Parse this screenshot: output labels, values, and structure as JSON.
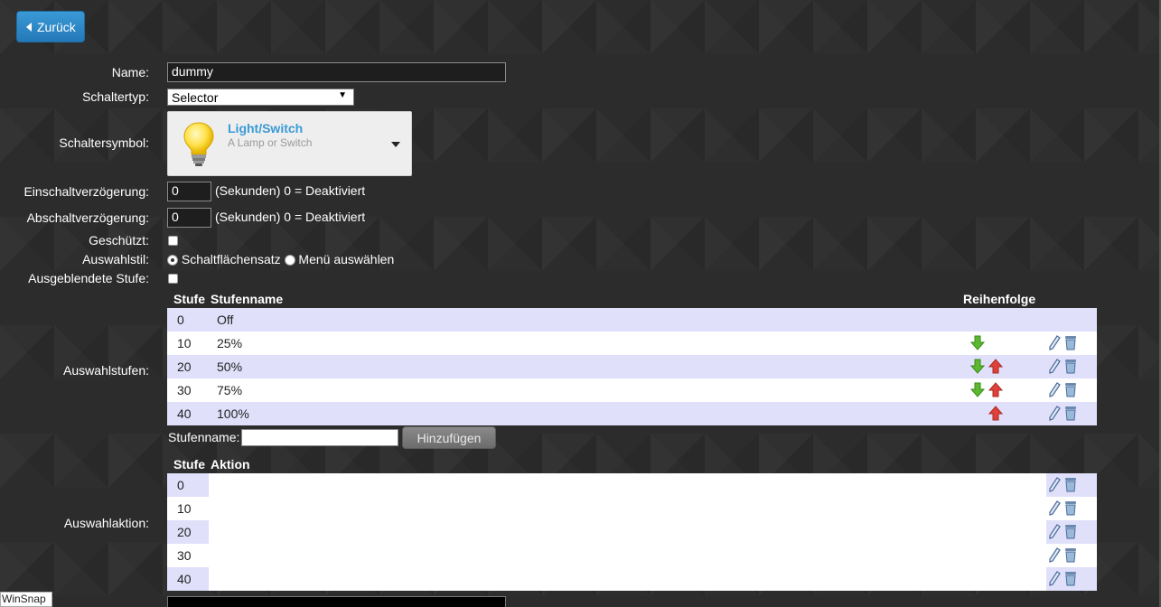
{
  "back_button": {
    "label": "Zurück"
  },
  "form": {
    "name": {
      "label": "Name:",
      "value": "dummy"
    },
    "switch_type": {
      "label": "Schaltertyp:",
      "value": "Selector"
    },
    "switch_symbol": {
      "label": "Schaltersymbol:",
      "title": "Light/Switch",
      "description": "A Lamp or Switch",
      "icon": "light-bulb-icon"
    },
    "on_delay": {
      "label": "Einschaltverzögerung:",
      "value": "0",
      "hint": "(Sekunden) 0 = Deaktiviert"
    },
    "off_delay": {
      "label": "Abschaltverzögerung:",
      "value": "0",
      "hint": "(Sekunden) 0 = Deaktiviert"
    },
    "protected": {
      "label": "Geschützt:",
      "checked": false
    },
    "selector_style": {
      "label": "Auswahlstil:",
      "options": [
        "Schaltflächensatz",
        "Menü auswählen"
      ],
      "selected": "Schaltflächensatz"
    },
    "hidden_level": {
      "label": "Ausgeblendete Stufe:",
      "checked": false
    }
  },
  "levels": {
    "label": "Auswahlstufen:",
    "headers": {
      "level": "Stufe",
      "name": "Stufenname",
      "order": "Reihenfolge"
    },
    "rows": [
      {
        "level": "0",
        "name": "Off"
      },
      {
        "level": "10",
        "name": "25%"
      },
      {
        "level": "20",
        "name": "50%"
      },
      {
        "level": "30",
        "name": "75%"
      },
      {
        "level": "40",
        "name": "100%"
      }
    ],
    "add_label": "Stufenname:",
    "add_button": "Hinzufügen"
  },
  "actions": {
    "label": "Auswahlaktion:",
    "headers": {
      "level": "Stufe",
      "action": "Aktion"
    },
    "rows": [
      {
        "level": "0"
      },
      {
        "level": "10"
      },
      {
        "level": "20"
      },
      {
        "level": "30"
      },
      {
        "level": "40"
      }
    ]
  },
  "overlay": {
    "winsnap": "WinSnap"
  },
  "colors": {
    "accent": "#3a9ad6",
    "row_alt": "#e0e0fb",
    "arrow_down": "#5cb82e",
    "arrow_up": "#e0403a"
  }
}
